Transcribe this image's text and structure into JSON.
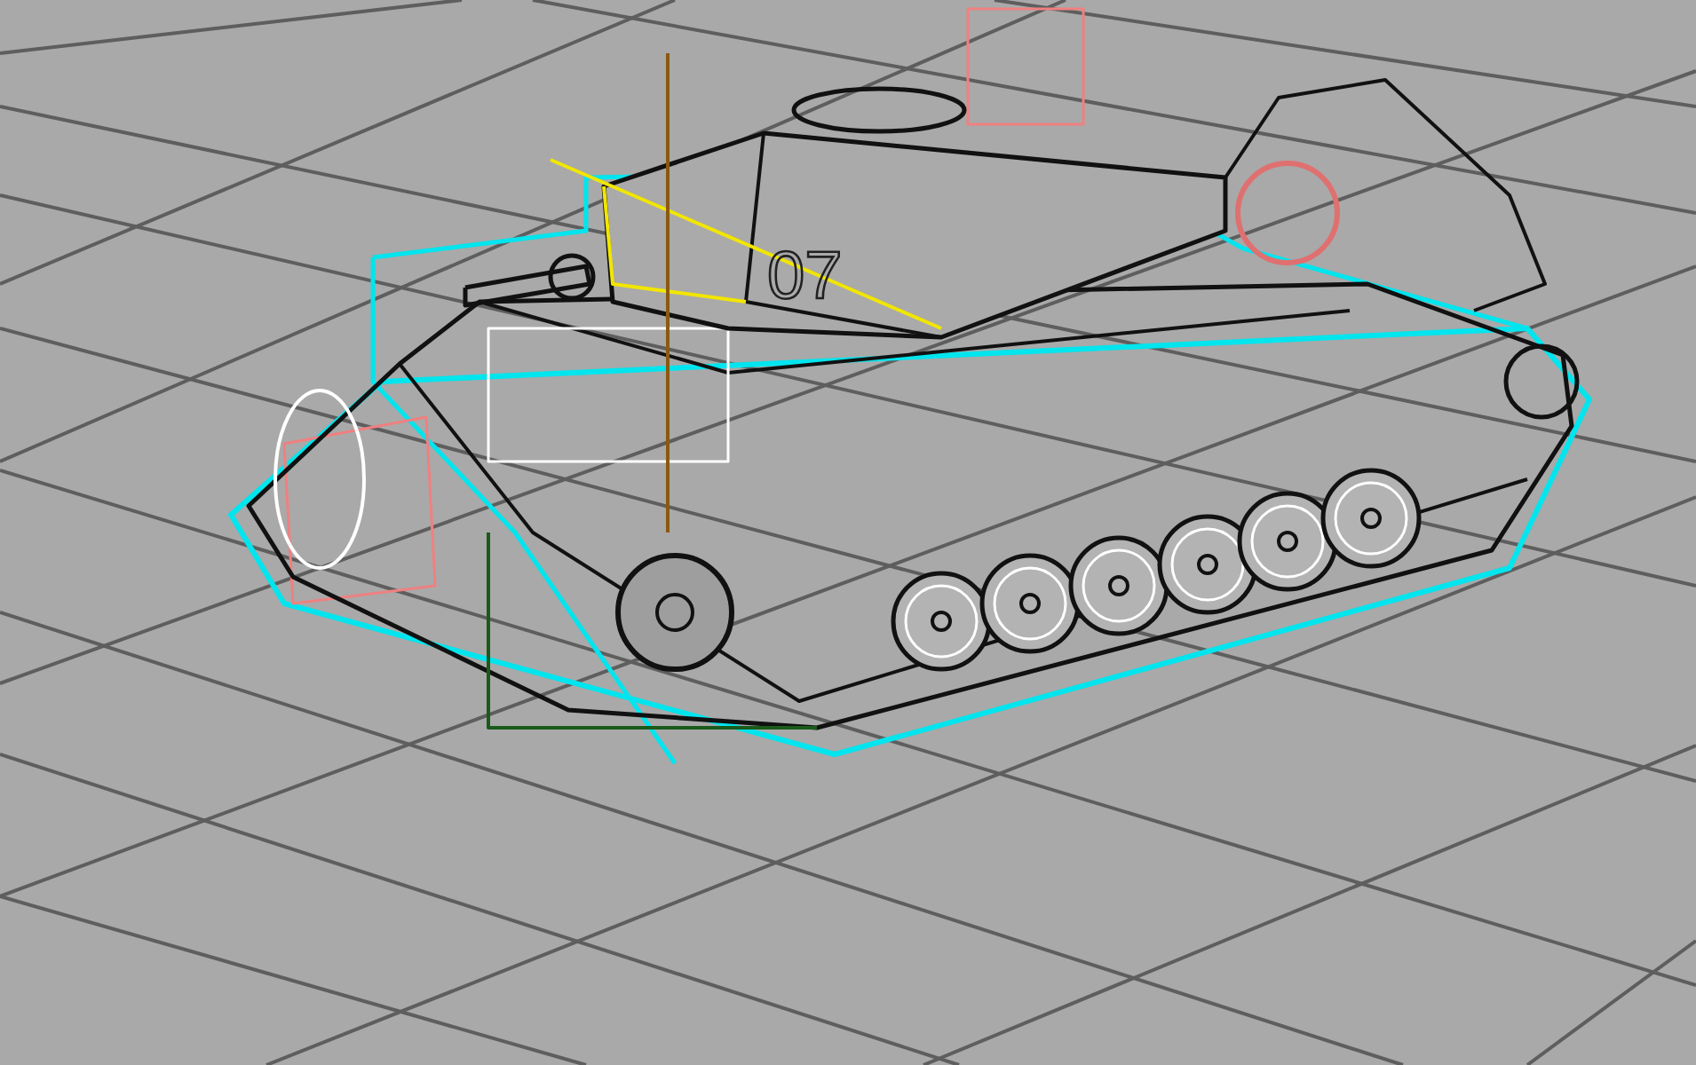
{
  "viewport": {
    "grid": true,
    "turret_number": "07"
  }
}
